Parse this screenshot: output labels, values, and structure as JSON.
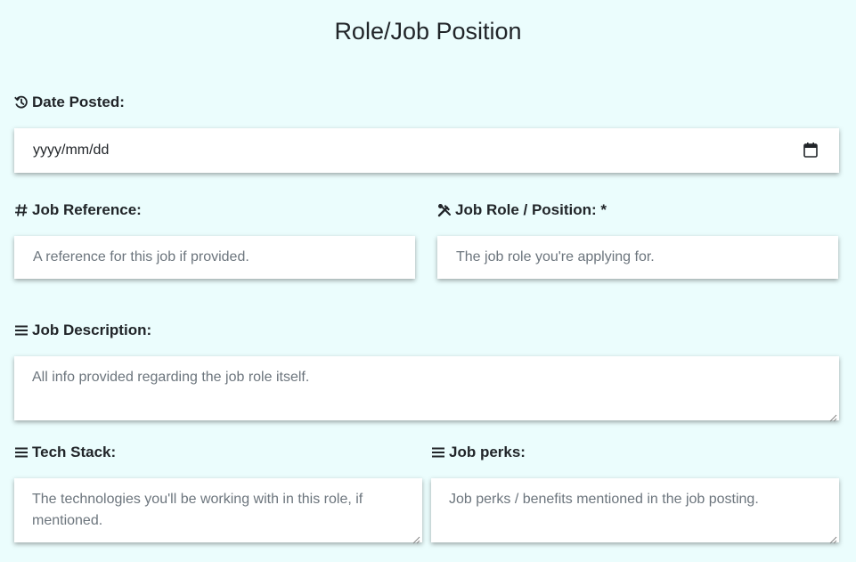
{
  "page": {
    "title": "Role/Job Position"
  },
  "date_posted": {
    "label": "Date Posted:",
    "icon": "history-icon",
    "value_text": "yyyy/mm/dd"
  },
  "job_reference": {
    "label": "Job Reference:",
    "icon": "hash-icon",
    "placeholder": "A reference for this job if provided."
  },
  "job_role": {
    "label": "Job Role / Position: *",
    "icon": "tools-icon",
    "placeholder": "The job role you're applying for."
  },
  "job_description": {
    "label": "Job Description:",
    "icon": "list-icon",
    "placeholder": "All info provided regarding the job role itself."
  },
  "tech_stack": {
    "label": "Tech Stack:",
    "icon": "list-icon",
    "placeholder": "The technologies you'll be working with in this role, if mentioned."
  },
  "job_perks": {
    "label": "Job perks:",
    "icon": "list-icon",
    "placeholder": "Job perks / benefits mentioned in the job posting."
  },
  "colors": {
    "background": "#ebfdfd",
    "field_background": "#ffffff",
    "text": "#212529",
    "placeholder": "#6c757d"
  }
}
